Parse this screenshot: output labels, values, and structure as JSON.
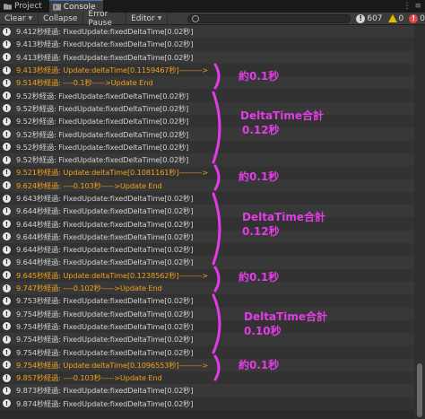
{
  "tabs": [
    {
      "label": "Project",
      "icon": "folder-icon"
    },
    {
      "label": "Console",
      "icon": "console-icon"
    }
  ],
  "toolbar": {
    "clear_label": "Clear",
    "collapse_label": "Collapse",
    "error_pause_label": "Error Pause",
    "editor_label": "Editor",
    "search_value": "",
    "info_count": "607",
    "warning_count": "0",
    "error_count": "0"
  },
  "log_rows": [
    {
      "text": "9.412秒経過: FixedUpdate:fixedDeltaTime[0.02秒]",
      "highlight": false
    },
    {
      "text": "9.413秒経過: FixedUpdate:fixedDeltaTime[0.02秒]",
      "highlight": false
    },
    {
      "text": "9.413秒経過: FixedUpdate:fixedDeltaTime[0.02秒]",
      "highlight": false
    },
    {
      "text": "9.413秒経過: Update:deltaTime[0.1159467秒]--------->",
      "highlight": true
    },
    {
      "text": "9.514秒経過: ----0.1秒----->Update End",
      "highlight": true
    },
    {
      "text": "9.52秒経過: FixedUpdate:fixedDeltaTime[0.02秒]",
      "highlight": false
    },
    {
      "text": "9.52秒経過: FixedUpdate:fixedDeltaTime[0.02秒]",
      "highlight": false
    },
    {
      "text": "9.52秒経過: FixedUpdate:fixedDeltaTime[0.02秒]",
      "highlight": false
    },
    {
      "text": "9.52秒経過: FixedUpdate:fixedDeltaTime[0.02秒]",
      "highlight": false
    },
    {
      "text": "9.52秒経過: FixedUpdate:fixedDeltaTime[0.02秒]",
      "highlight": false
    },
    {
      "text": "9.52秒経過: FixedUpdate:fixedDeltaTime[0.02秒]",
      "highlight": false
    },
    {
      "text": "9.521秒経過: Update:deltaTime[0.1081161秒]--------->",
      "highlight": true
    },
    {
      "text": "9.624秒経過: ----0.103秒----->Update End",
      "highlight": true
    },
    {
      "text": "9.643秒経過: FixedUpdate:fixedDeltaTime[0.02秒]",
      "highlight": false
    },
    {
      "text": "9.644秒経過: FixedUpdate:fixedDeltaTime[0.02秒]",
      "highlight": false
    },
    {
      "text": "9.644秒経過: FixedUpdate:fixedDeltaTime[0.02秒]",
      "highlight": false
    },
    {
      "text": "9.644秒経過: FixedUpdate:fixedDeltaTime[0.02秒]",
      "highlight": false
    },
    {
      "text": "9.644秒経過: FixedUpdate:fixedDeltaTime[0.02秒]",
      "highlight": false
    },
    {
      "text": "9.644秒経過: FixedUpdate:fixedDeltaTime[0.02秒]",
      "highlight": false
    },
    {
      "text": "9.645秒経過: Update:deltaTime[0.1238562秒]--------->",
      "highlight": true
    },
    {
      "text": "9.747秒経過: ----0.102秒----->Update End",
      "highlight": true
    },
    {
      "text": "9.753秒経過: FixedUpdate:fixedDeltaTime[0.02秒]",
      "highlight": false
    },
    {
      "text": "9.754秒経過: FixedUpdate:fixedDeltaTime[0.02秒]",
      "highlight": false
    },
    {
      "text": "9.754秒経過: FixedUpdate:fixedDeltaTime[0.02秒]",
      "highlight": false
    },
    {
      "text": "9.754秒経過: FixedUpdate:fixedDeltaTime[0.02秒]",
      "highlight": false
    },
    {
      "text": "9.754秒経過: FixedUpdate:fixedDeltaTime[0.02秒]",
      "highlight": false
    },
    {
      "text": "9.754秒経過: Update:deltaTime[0.1096553秒]--------->",
      "highlight": true
    },
    {
      "text": "9.857秒経過: ----0.103秒----->Update End",
      "highlight": true
    },
    {
      "text": "9.873秒経過: FixedUpdate:fixedDeltaTime[0.02秒]",
      "highlight": false
    },
    {
      "text": "9.874秒経過: FixedUpdate:fixedDeltaTime[0.02秒]",
      "highlight": false
    }
  ],
  "annotations": {
    "approx1": "約0.1秒",
    "approx2": "約0.1秒",
    "approx3": "約0.1秒",
    "approx4": "約0.1秒",
    "sum1_title": "DeltaTime合計",
    "sum1_value": "0.12秒",
    "sum2_title": "DeltaTime合計",
    "sum2_value": "0.12秒",
    "sum3_title": "DeltaTime合計",
    "sum3_value": "0.10秒"
  },
  "colors": {
    "highlight_text": "#f0a01a",
    "annotation": "#e23ce6"
  }
}
